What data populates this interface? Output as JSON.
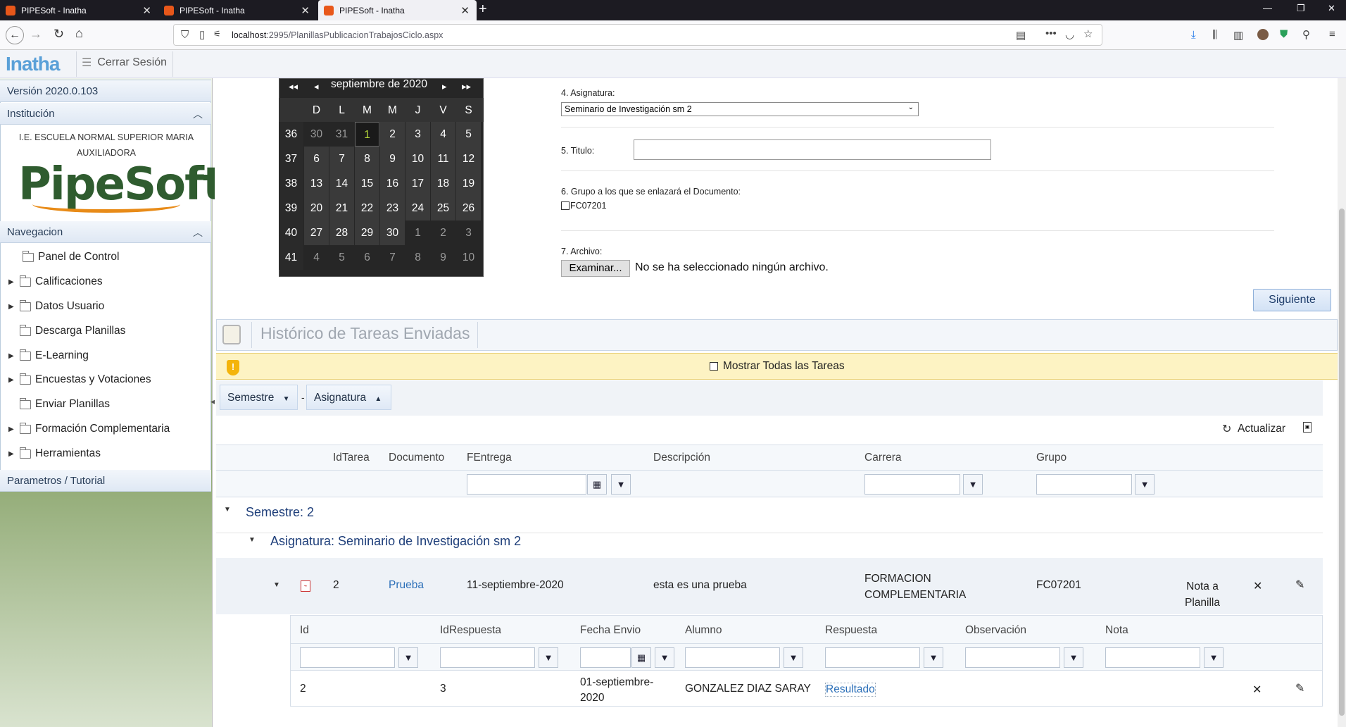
{
  "browser": {
    "tabs": [
      {
        "label": "PIPESoft - Inatha"
      },
      {
        "label": "PIPESoft - Inatha"
      },
      {
        "label": "PIPESoft - Inatha"
      }
    ],
    "url_host": "localhost",
    "url_rest": ":2995/PlanillasPublicacionTrabajosCiclo.aspx"
  },
  "app": {
    "logo": "Inatha",
    "logout": "Cerrar Sesión"
  },
  "sidebar": {
    "version": "Versión 2020.0.103",
    "institution_header": "Institución",
    "institution_name": "I.E. ESCUELA NORMAL SUPERIOR MARIA AUXILIADORA",
    "institution_logo": "PipeSoft",
    "nav_header": "Navegacion",
    "items": [
      {
        "label": "Panel de Control",
        "expandable": false
      },
      {
        "label": "Calificaciones",
        "expandable": true
      },
      {
        "label": "Datos Usuario",
        "expandable": true
      },
      {
        "label": "Descarga Planillas",
        "expandable": false
      },
      {
        "label": "E-Learning",
        "expandable": true
      },
      {
        "label": "Encuestas y Votaciones",
        "expandable": true
      },
      {
        "label": "Enviar Planillas",
        "expandable": false
      },
      {
        "label": "Formación Complementaria",
        "expandable": true
      },
      {
        "label": "Herramientas",
        "expandable": true
      }
    ],
    "footer": "Parametros / Tutorial"
  },
  "calendar": {
    "month": "septiembre de 2020",
    "nav": {
      "prev_year": "◂◂",
      "prev": "◂",
      "next": "▸",
      "next_year": "▸▸"
    },
    "days_of_week": [
      "D",
      "L",
      "M",
      "M",
      "J",
      "V",
      "S"
    ],
    "weeks": [
      {
        "week": "36",
        "days": [
          "30",
          "31",
          "1",
          "2",
          "3",
          "4",
          "5"
        ]
      },
      {
        "week": "37",
        "days": [
          "6",
          "7",
          "8",
          "9",
          "10",
          "11",
          "12"
        ]
      },
      {
        "week": "38",
        "days": [
          "13",
          "14",
          "15",
          "16",
          "17",
          "18",
          "19"
        ]
      },
      {
        "week": "39",
        "days": [
          "20",
          "21",
          "22",
          "23",
          "24",
          "25",
          "26"
        ]
      },
      {
        "week": "40",
        "days": [
          "27",
          "28",
          "29",
          "30",
          "1",
          "2",
          "3"
        ]
      },
      {
        "week": "41",
        "days": [
          "4",
          "5",
          "6",
          "7",
          "8",
          "9",
          "10"
        ]
      }
    ],
    "selected": "1"
  },
  "form": {
    "asignatura_label": "4. Asignatura:",
    "asignatura_value": "Seminario de Investigación sm 2",
    "titulo_label": "5. Titulo:",
    "titulo_value": "",
    "grupo_label": "6. Grupo a los que se enlazará el Documento:",
    "grupo_option": "FC07201",
    "archivo_label": "7. Archivo:",
    "examinar": "Examinar...",
    "no_file": "No se ha seleccionado ningún archivo.",
    "siguiente": "Siguiente"
  },
  "history": {
    "title": "Histórico de Tareas Enviadas",
    "show_all": "Mostrar Todas las Tareas",
    "group_semestre": "Semestre",
    "group_sep": "-",
    "group_asignatura": "Asignatura",
    "refresh": "Actualizar",
    "columns": [
      "IdTarea",
      "Documento",
      "FEntrega",
      "Descripción",
      "Carrera",
      "Grupo"
    ],
    "group1": "Semestre: 2",
    "group2": "Asignatura: Seminario de Investigación sm 2",
    "row": {
      "id": "2",
      "documento": "Prueba",
      "fentrega": "11-septiembre-2020",
      "descripcion": "esta es una prueba",
      "carrera": "FORMACION COMPLEMENTARIA",
      "grupo": "FC07201",
      "action": "Nota a Planilla"
    },
    "detail_columns": [
      "Id",
      "IdRespuesta",
      "Fecha Envio",
      "Alumno",
      "Respuesta",
      "Observación",
      "Nota"
    ],
    "detail_row": {
      "id": "2",
      "idrespuesta": "3",
      "fecha": "01-septiembre-2020",
      "alumno": "GONZALEZ DIAZ SARAY",
      "respuesta": "Resultado"
    }
  }
}
